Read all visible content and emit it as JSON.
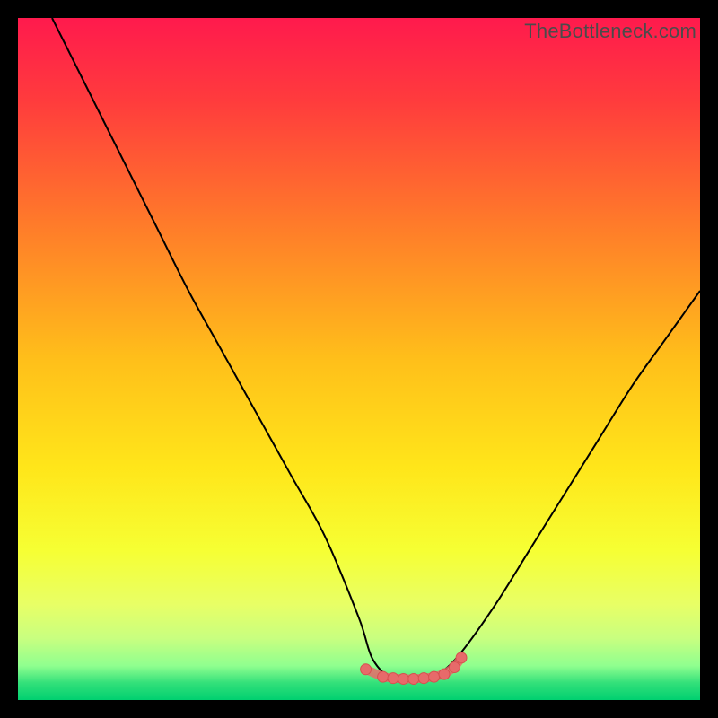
{
  "watermark": "TheBottleneck.com",
  "colors": {
    "black": "#000000",
    "curve_stroke": "#000000",
    "marker_fill": "#e76a6a",
    "marker_stroke": "#d74f4f"
  },
  "gradient_stops": [
    {
      "offset": 0.0,
      "color": "#ff1a4d"
    },
    {
      "offset": 0.12,
      "color": "#ff3b3d"
    },
    {
      "offset": 0.3,
      "color": "#ff7a2a"
    },
    {
      "offset": 0.5,
      "color": "#ffbf1a"
    },
    {
      "offset": 0.66,
      "color": "#ffe61a"
    },
    {
      "offset": 0.78,
      "color": "#f6ff33"
    },
    {
      "offset": 0.86,
      "color": "#e8ff66"
    },
    {
      "offset": 0.91,
      "color": "#c8ff80"
    },
    {
      "offset": 0.95,
      "color": "#8fff8f"
    },
    {
      "offset": 0.975,
      "color": "#33e07a"
    },
    {
      "offset": 1.0,
      "color": "#00d070"
    }
  ],
  "chart_data": {
    "type": "line",
    "title": "",
    "xlabel": "",
    "ylabel": "",
    "xlim": [
      0,
      100
    ],
    "ylim": [
      0,
      100
    ],
    "series": [
      {
        "name": "bottleneck-curve",
        "x": [
          5,
          10,
          15,
          20,
          25,
          30,
          35,
          40,
          45,
          50,
          52,
          55,
          58,
          60,
          62,
          65,
          70,
          75,
          80,
          85,
          90,
          95,
          100
        ],
        "values": [
          100,
          90,
          80,
          70,
          60,
          51,
          42,
          33,
          24,
          12,
          6,
          3,
          3,
          3,
          4,
          7,
          14,
          22,
          30,
          38,
          46,
          53,
          60
        ]
      }
    ],
    "highlight_region": {
      "x_start": 51,
      "x_end": 65,
      "note": "optimal zone markers"
    },
    "markers": {
      "x": [
        51.0,
        53.5,
        55.0,
        56.5,
        58.0,
        59.5,
        61.0,
        62.5,
        64.0,
        65.0
      ],
      "values": [
        4.5,
        3.4,
        3.2,
        3.1,
        3.1,
        3.2,
        3.4,
        3.8,
        4.8,
        6.2
      ]
    }
  }
}
